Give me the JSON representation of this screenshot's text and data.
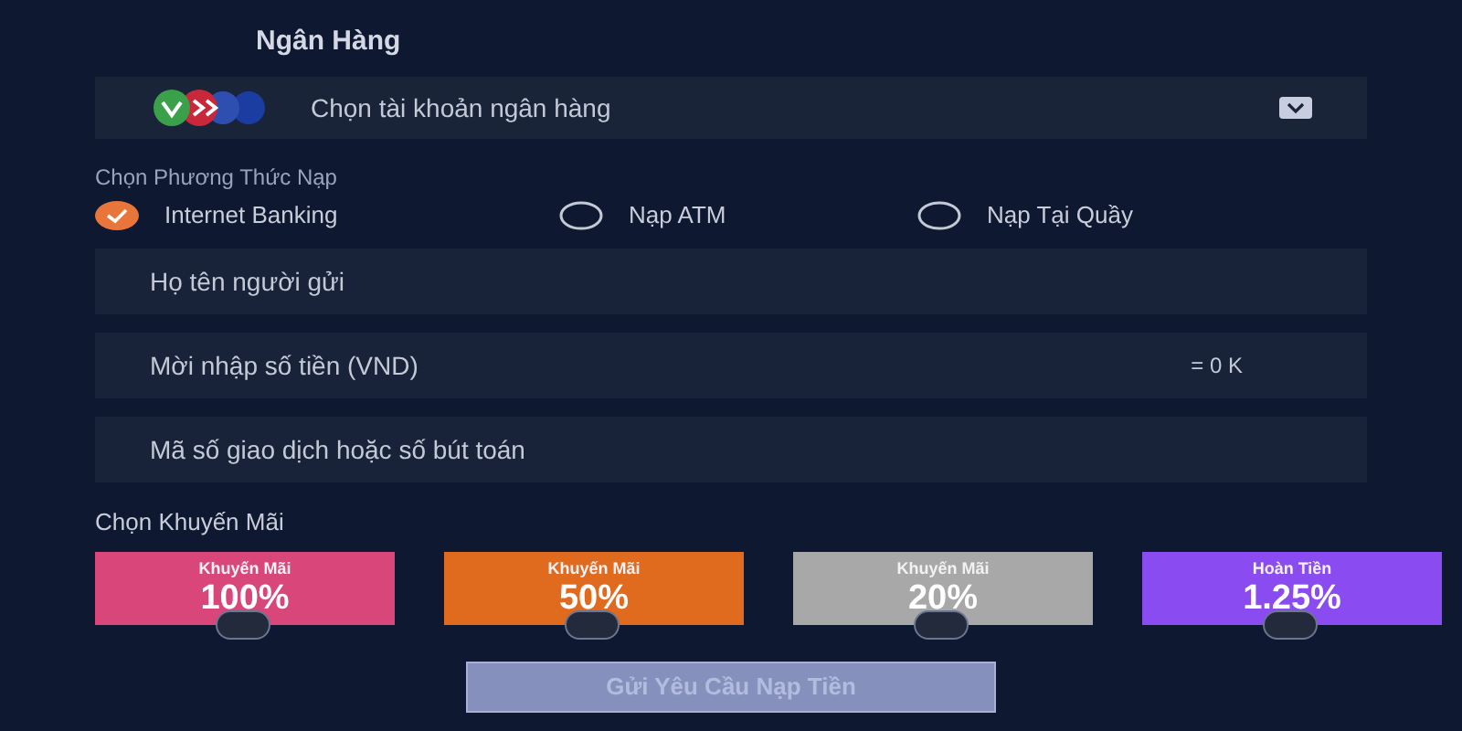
{
  "title": "Ngân Hàng",
  "bank_select": {
    "placeholder": "Chọn tài khoản ngân hàng"
  },
  "method_label": "Chọn Phương Thức Nạp",
  "methods": [
    {
      "label": "Internet Banking",
      "selected": true
    },
    {
      "label": "Nạp ATM",
      "selected": false
    },
    {
      "label": "Nạp Tại Quầy",
      "selected": false
    }
  ],
  "fields": [
    {
      "placeholder": "Họ tên người gửi"
    },
    {
      "placeholder": "Mời nhập số tiền (VND)",
      "suffix": "= 0 K"
    },
    {
      "placeholder": "Mã số giao dịch hoặc số bút toán"
    }
  ],
  "promo_label": "Chọn Khuyến Mãi",
  "promos": [
    {
      "caption": "Khuyến Mãi",
      "value": "100%",
      "color": "#d9477a",
      "selected": false
    },
    {
      "caption": "Khuyến Mãi",
      "value": "50%",
      "color": "#e06a1e",
      "selected": false
    },
    {
      "caption": "Khuyến Mãi",
      "value": "20%",
      "color": "#a8a8a8",
      "selected": false
    },
    {
      "caption": "Hoàn Tiền",
      "value": "1.25%",
      "color": "#8a4cf0",
      "selected": false
    }
  ],
  "submit": "Gửi Yêu Cầu Nạp Tiền"
}
